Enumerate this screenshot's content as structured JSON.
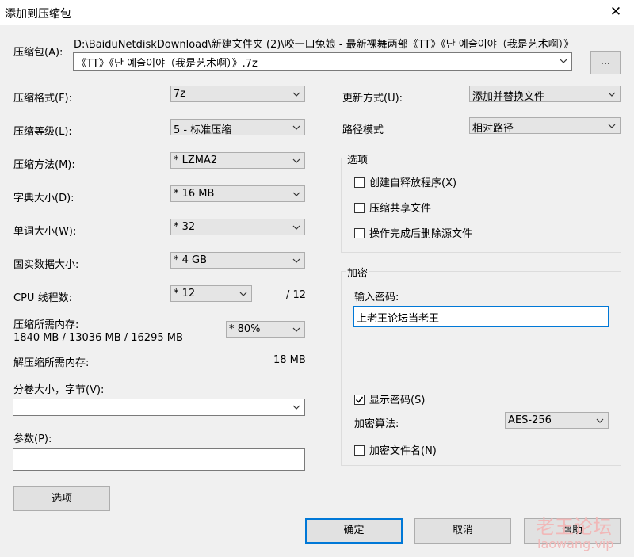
{
  "window": {
    "title": "添加到压缩包",
    "close_glyph": "✕"
  },
  "archive": {
    "label": "压缩包(A):",
    "path": "D:\\BaiduNetdiskDownload\\新建文件夹 (2)\\咬一口兔娘 - 最新裸舞两部《TT》《난 예술이야（我是艺术啊）》",
    "name": "《TT》《난 예술이야（我是艺术啊）》.7z",
    "browse_label": "..."
  },
  "left": {
    "format": {
      "label": "压缩格式(F):",
      "value": "7z"
    },
    "level": {
      "label": "压缩等级(L):",
      "value": "5 - 标准压缩"
    },
    "method": {
      "label": "压缩方法(M):",
      "value": "*  LZMA2"
    },
    "dict": {
      "label": "字典大小(D):",
      "value": "*  16 MB"
    },
    "word": {
      "label": "单词大小(W):",
      "value": "*  32"
    },
    "solid": {
      "label": "固实数据大小:",
      "value": "*  4 GB"
    },
    "cpu": {
      "label": "CPU 线程数:",
      "value": "*  12",
      "total": "/ 12"
    },
    "mem_compress": {
      "label": "压缩所需内存:",
      "value": "1840 MB / 13036 MB / 16295 MB",
      "percent": "* 80%"
    },
    "mem_decompress": {
      "label": "解压缩所需内存:",
      "value": "18 MB"
    },
    "volume": {
      "label": "分卷大小，字节(V):",
      "value": ""
    },
    "params": {
      "label": "参数(P):",
      "value": ""
    },
    "options_button": "选项"
  },
  "right": {
    "update": {
      "label": "更新方式(U):",
      "value": "添加并替换文件"
    },
    "path_mode": {
      "label": "路径模式",
      "value": "相对路径"
    },
    "options_group": {
      "title": "选项",
      "items": [
        {
          "label": "创建自释放程序(X)",
          "checked": false
        },
        {
          "label": "压缩共享文件",
          "checked": false
        },
        {
          "label": "操作完成后删除源文件",
          "checked": false
        }
      ]
    },
    "encryption": {
      "title": "加密",
      "password_label": "输入密码:",
      "password_value": "上老王论坛当老王",
      "show_password": {
        "label": "显示密码(S)",
        "checked": true
      },
      "algorithm_label": "加密算法:",
      "algorithm_value": "AES-256",
      "encrypt_names": {
        "label": "加密文件名(N)",
        "checked": false
      }
    }
  },
  "buttons": {
    "ok": "确定",
    "cancel": "取消",
    "help": "帮助"
  },
  "watermark": {
    "line1": "老王论坛",
    "line2": "laowang.vip"
  }
}
